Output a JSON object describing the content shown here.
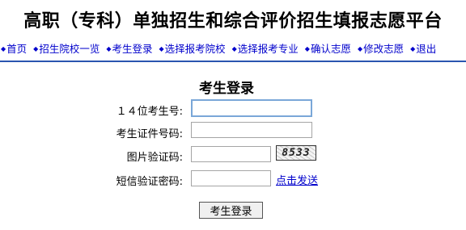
{
  "site": {
    "title": "高职（专科）单独招生和综合评价招生填报志愿平台"
  },
  "nav": {
    "items": [
      {
        "label": "首页"
      },
      {
        "label": "招生院校一览"
      },
      {
        "label": "考生登录"
      },
      {
        "label": "选择报考院校"
      },
      {
        "label": "选择报考专业"
      },
      {
        "label": "确认志愿"
      },
      {
        "label": "修改志愿"
      },
      {
        "label": "退出"
      }
    ],
    "bullet": "◆"
  },
  "login": {
    "heading": "考生登录",
    "fields": {
      "exam_no_label": "１４位考生号:",
      "exam_no_value": "",
      "id_no_label": "考生证件号码:",
      "id_no_value": "",
      "captcha_label": "图片验证码:",
      "captcha_value": "",
      "captcha_text": "8533",
      "sms_label": "短信验证密码:",
      "sms_value": ""
    },
    "send_link": "点击发送",
    "submit_label": "考生登录"
  },
  "colors": {
    "link": "#0000cc",
    "rule": "#2a55b0",
    "focus_border": "#7aa7d8"
  }
}
